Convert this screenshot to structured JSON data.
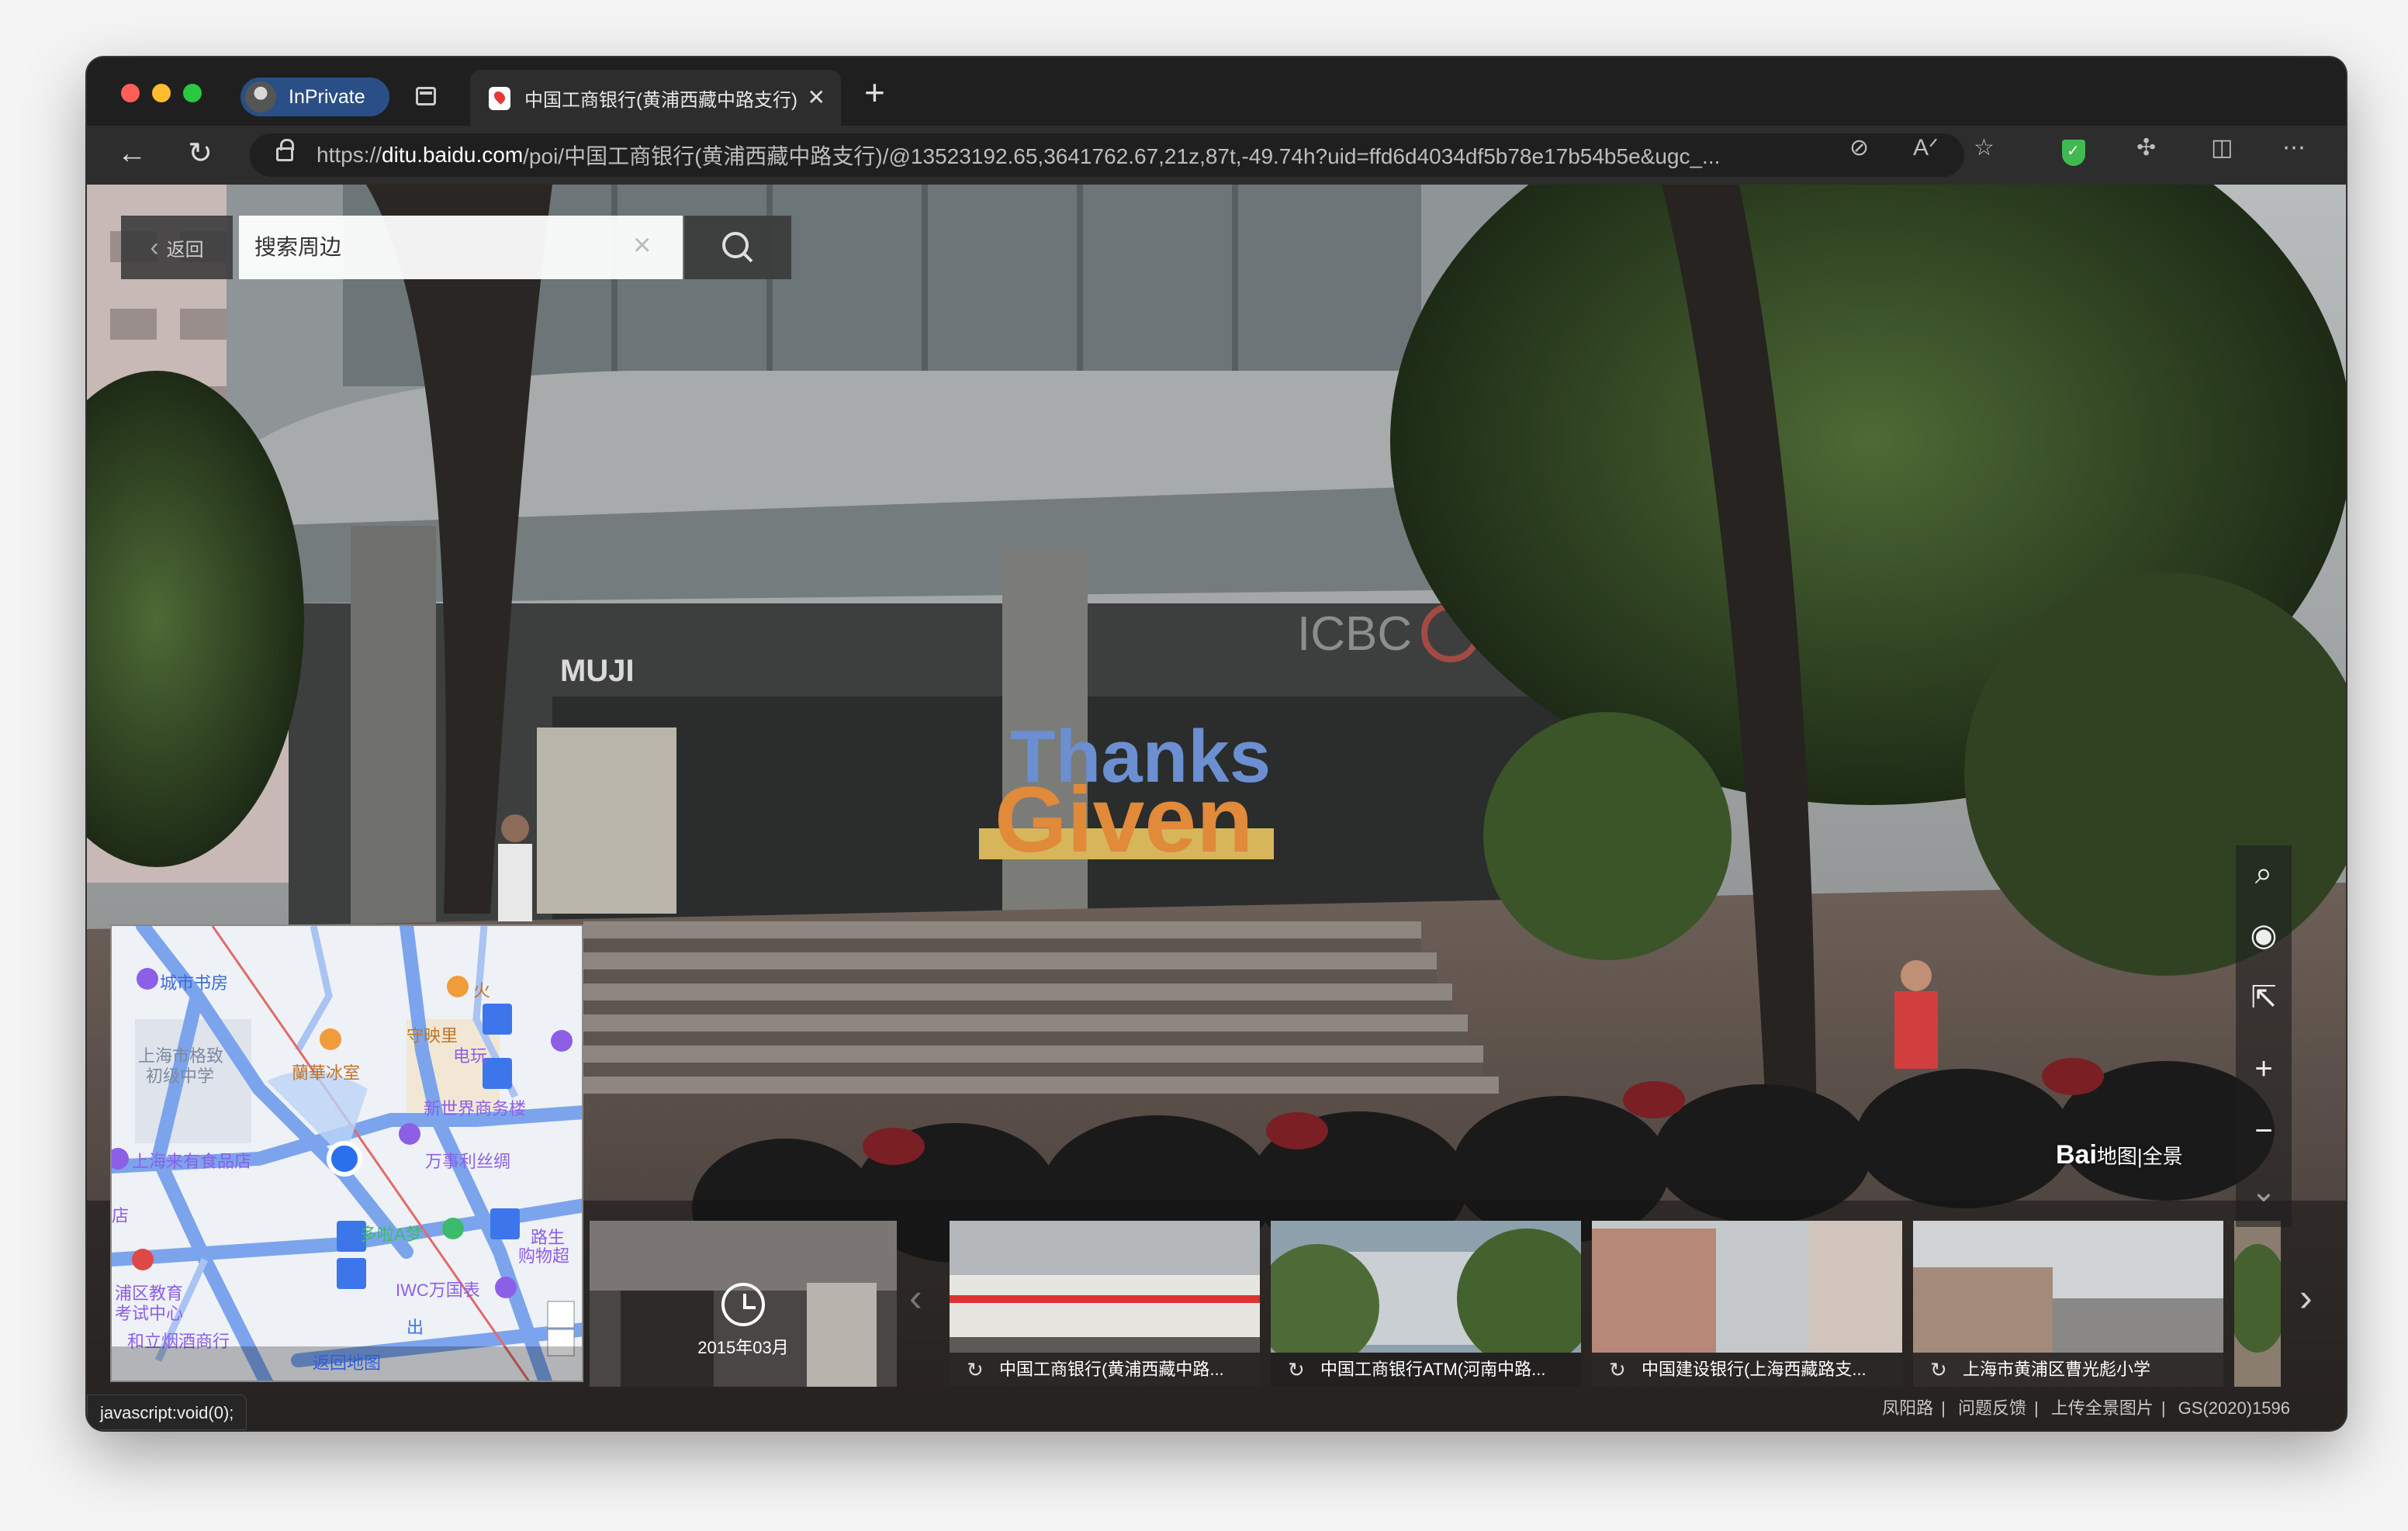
{
  "browser": {
    "inprivate_label": "InPrivate",
    "tab_title": "中国工商银行(黄浦西藏中路支行)",
    "url_prefix": "https://",
    "url_host": "ditu.baidu.com",
    "url_path": "/poi/中国工商银行(黄浦西藏中路支行)/@13523192.65,3641762.67,21z,87t,-49.74h?uid=ffd6d4034df5b78e17b54b5e&ugc_..."
  },
  "pano": {
    "back_label": "返回",
    "search_placeholder": "搜索周边",
    "watermark_brand": "Bai",
    "watermark_text": "地图|全景",
    "history_date": "2015年03月",
    "thumbs": [
      "中国工商银行(黄浦西藏中路...",
      "中国工商银行ATM(河南中路...",
      "中国建设银行(上海西藏路支...",
      "上海市黄浦区曹光彪小学"
    ],
    "footer_links": [
      "凤阳路",
      "问题反馈",
      "上传全景图片",
      "GS(2020)1596"
    ],
    "signs": {
      "muji": "MUJI",
      "icbc": "ICBC",
      "art_line1": "Thanks",
      "art_line2": "Given"
    }
  },
  "mini_map": {
    "labels": [
      "城市书房",
      "上海市格致",
      "初级中学",
      "蘭華冰室",
      "守映里",
      "电玩",
      "新世界商务楼",
      "万事利丝绸",
      "上海来有食品店",
      "多啦A梦",
      "IWC万国表",
      "购物超",
      "浦区教育",
      "考试中心",
      "和立烟酒商行",
      "火",
      "路生",
      "店",
      "出"
    ],
    "back_label": "返回地图"
  },
  "status_bar": "javascript:void(0);",
  "colors": {
    "accent": "#2a4f86",
    "map_road": "#7ba4ec",
    "map_bg": "#eef1f6"
  }
}
